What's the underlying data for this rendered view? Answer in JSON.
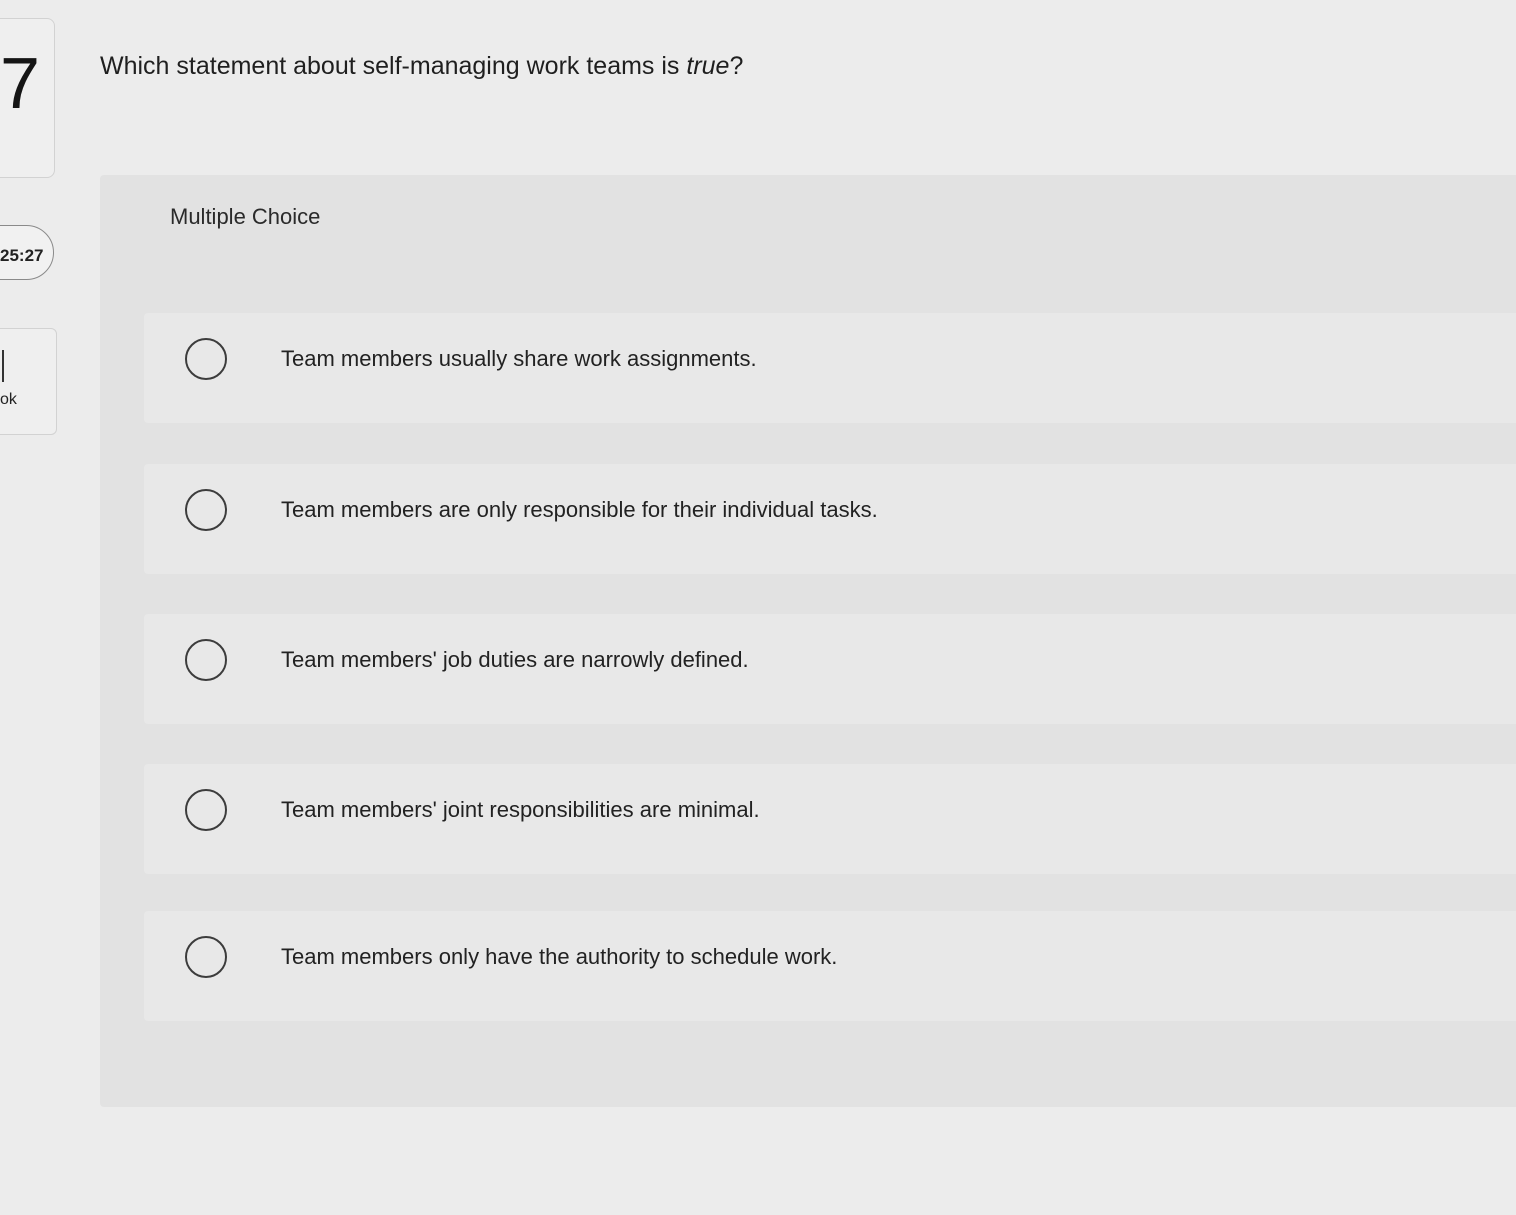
{
  "sidebar": {
    "question_number": "7",
    "timer": "25:27",
    "ebook_label": "ok"
  },
  "question": {
    "text_before": "Which statement about self-managing work teams is ",
    "emphasis": "true",
    "text_after": "?"
  },
  "answer_panel": {
    "label": "Multiple Choice",
    "choices": [
      {
        "label": "Team members usually share work assignments."
      },
      {
        "label": "Team members are only responsible for their individual tasks."
      },
      {
        "label": "Team members' job duties are narrowly defined."
      },
      {
        "label": "Team members' joint responsibilities are minimal."
      },
      {
        "label": "Team members only have the authority to schedule work."
      }
    ]
  },
  "colors": {
    "background": "#ececec",
    "panel": "#e2e2e2",
    "choice": "#e8e8e8",
    "text": "#222222"
  }
}
